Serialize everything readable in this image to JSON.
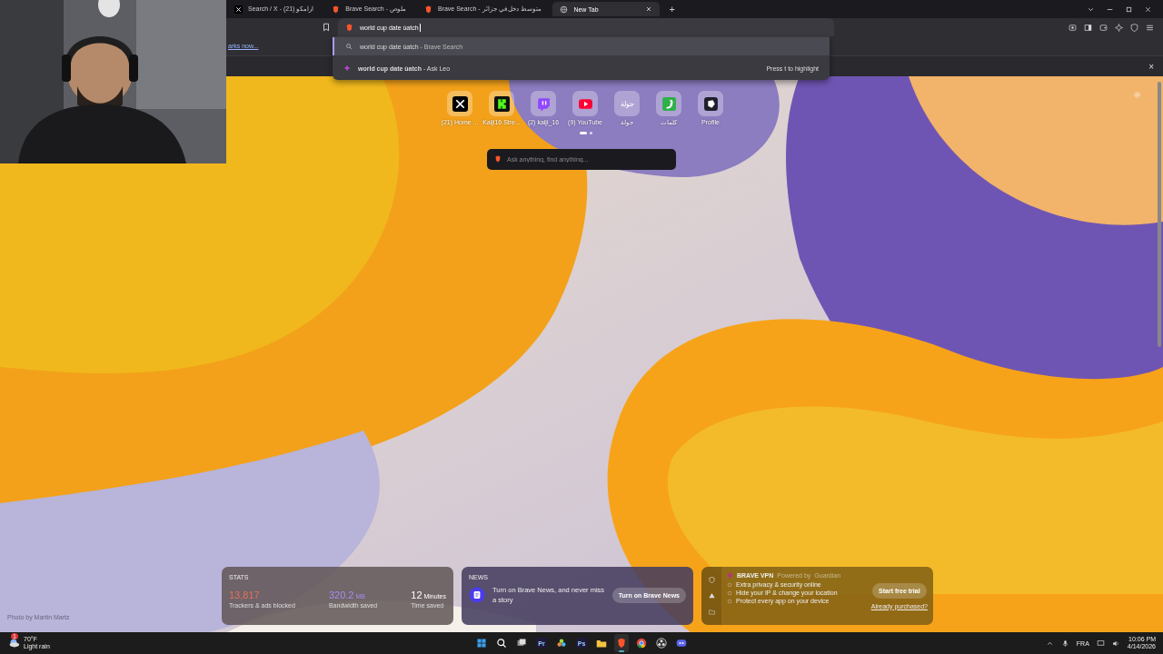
{
  "tabs": [
    {
      "title": "Search / X - (21) ارامكو",
      "selected": false
    },
    {
      "title": "Brave Search - ملوص",
      "selected": false
    },
    {
      "title": "Brave Search - متوسط دخل في جزائر",
      "selected": false
    },
    {
      "title": "New Tab",
      "selected": true
    }
  ],
  "new_tab_button": "+",
  "omnibox": {
    "value": "world cup date ùatch"
  },
  "suggestions": [
    {
      "kind": "search",
      "text": "world cup date ùatch",
      "suffix": " - Brave Search",
      "selected": true
    },
    {
      "kind": "leo",
      "text": "world cup date ùatch",
      "suffix": " - Ask Leo",
      "hint": "Press t to highlight",
      "selected": false
    }
  ],
  "bookmarks_bar": {
    "text": "arks now..."
  },
  "notification_close": "×",
  "top_sites": [
    {
      "label": "(21) Home ..."
    },
    {
      "label": "Kaiji16 Stre..."
    },
    {
      "label": "(2) kaiji_16"
    },
    {
      "label": "(9) YouTube"
    },
    {
      "label": "جولة",
      "tile_text": "جولة"
    },
    {
      "label": "كلمات"
    },
    {
      "label": "Profile"
    }
  ],
  "pager": [
    {
      "selected": true
    },
    {
      "selected": false
    }
  ],
  "search": {
    "placeholder": "Ask anything, find anything..."
  },
  "photo_credit": "Photo by Martin Martz",
  "stats": {
    "title": "STATS",
    "items": [
      {
        "value": "13,817",
        "label": "Trackers & ads blocked",
        "color": "#e8705a"
      },
      {
        "value": "320.2",
        "unit": "MB",
        "label": "Bandwidth saved",
        "color": "#a48ff0"
      },
      {
        "value": "12",
        "unit": "Minutes",
        "label": "Time saved",
        "color": "#ffffff"
      }
    ]
  },
  "news": {
    "title": "NEWS",
    "text": "Turn on Brave News, and never miss a story",
    "button": "Turn on Brave News"
  },
  "vpn": {
    "title": "BRAVE VPN",
    "powered": "Powered by",
    "partner": "Guardian",
    "features": [
      "Extra privacy & security online",
      "Hide your IP & change your location",
      "Protect every app on your device"
    ],
    "button": "Start free trial",
    "link": "Already purchased?"
  },
  "taskbar": {
    "temp": "70°F",
    "weather": "Light rain",
    "weather_badge": "1",
    "apps": [
      {
        "running": false
      },
      {
        "running": false
      },
      {
        "running": false
      },
      {
        "label": "Pr",
        "running": false
      },
      {
        "running": false
      },
      {
        "label": "Ps",
        "running": false
      },
      {
        "running": false
      },
      {
        "running": true
      },
      {
        "running": false
      },
      {
        "running": false
      },
      {
        "running": false
      }
    ],
    "language": "FRA",
    "time": "10:06 PM",
    "date": "4/14/2026"
  }
}
